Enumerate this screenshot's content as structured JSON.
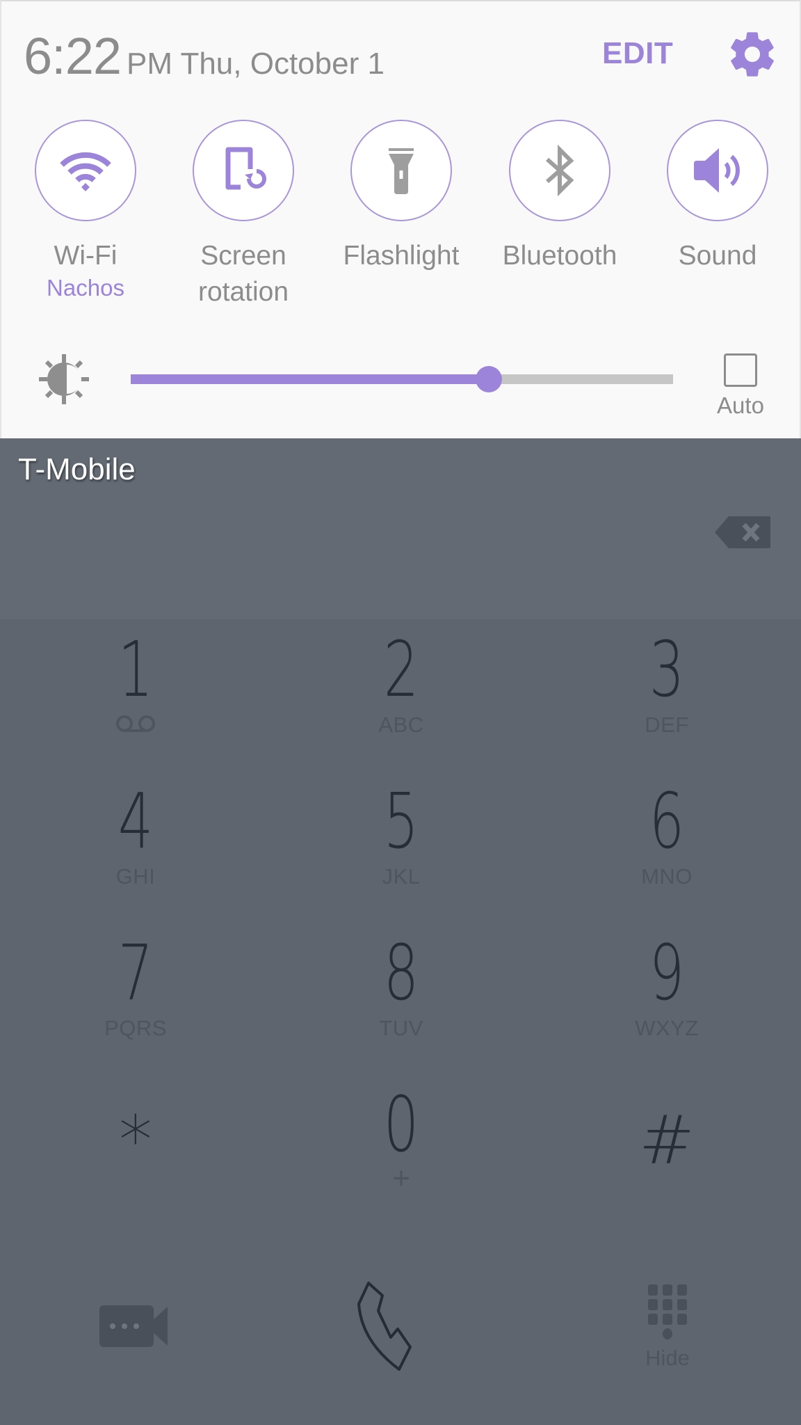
{
  "quick_settings": {
    "time": "6:22",
    "ampm_date": "PM Thu, October 1",
    "edit_label": "EDIT",
    "toggles": [
      {
        "label": "Wi-Fi",
        "sub": "Nachos",
        "icon": "wifi-icon",
        "state": "on"
      },
      {
        "label": "Screen\nrotation",
        "line1": "Screen",
        "line2": "rotation",
        "icon": "screen-rotation-icon",
        "state": "on"
      },
      {
        "label": "Flashlight",
        "icon": "flashlight-icon",
        "state": "off"
      },
      {
        "label": "Bluetooth",
        "icon": "bluetooth-icon",
        "state": "off"
      },
      {
        "label": "Sound",
        "icon": "sound-icon",
        "state": "on"
      }
    ],
    "brightness": {
      "value": 0.66,
      "auto_label": "Auto",
      "auto_checked": false
    }
  },
  "dialer": {
    "carrier": "T-Mobile",
    "keys": [
      {
        "digit": "1",
        "letters": ""
      },
      {
        "digit": "2",
        "letters": "ABC"
      },
      {
        "digit": "3",
        "letters": "DEF"
      },
      {
        "digit": "4",
        "letters": "GHI"
      },
      {
        "digit": "5",
        "letters": "JKL"
      },
      {
        "digit": "6",
        "letters": "MNO"
      },
      {
        "digit": "7",
        "letters": "PQRS"
      },
      {
        "digit": "8",
        "letters": "TUV"
      },
      {
        "digit": "9",
        "letters": "WXYZ"
      },
      {
        "digit": "*",
        "letters": ""
      },
      {
        "digit": "0",
        "letters": "+"
      },
      {
        "digit": "#",
        "letters": ""
      }
    ],
    "hide_label": "Hide"
  },
  "colors": {
    "accent": "#9b84d9",
    "panel_bg": "#f9f9f9",
    "dialer_bg": "#5e656e",
    "text_grey": "#8c8c8c"
  }
}
